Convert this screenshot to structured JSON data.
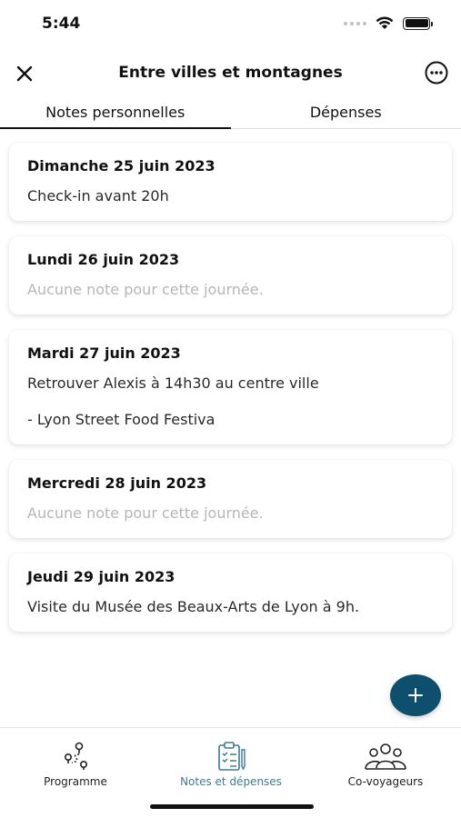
{
  "status_bar": {
    "time": "5:44"
  },
  "header": {
    "title": "Entre villes et montagnes"
  },
  "tabs": [
    {
      "label": "Notes personnelles",
      "active": true
    },
    {
      "label": "Dépenses",
      "active": false
    }
  ],
  "notes": [
    {
      "date": "Dimanche 25 juin 2023",
      "lines": [
        "Check-in avant 20h"
      ],
      "empty": false
    },
    {
      "date": "Lundi 26 juin 2023",
      "lines": [
        "Aucune note pour cette journée."
      ],
      "empty": true
    },
    {
      "date": "Mardi 27 juin 2023",
      "lines": [
        "Retrouver Alexis à 14h30 au centre ville",
        "- Lyon Street Food Festiva"
      ],
      "empty": false
    },
    {
      "date": "Mercredi 28 juin 2023",
      "lines": [
        "Aucune note pour cette journée."
      ],
      "empty": true
    },
    {
      "date": "Jeudi 29 juin 2023",
      "lines": [
        "Visite du Musée des Beaux-Arts de Lyon à 9h."
      ],
      "empty": false
    }
  ],
  "fab": {
    "icon": "plus-icon",
    "color": "#0f4f6e"
  },
  "bottom_nav": [
    {
      "label": "Programme",
      "icon": "route-icon",
      "active": false
    },
    {
      "label": "Notes et dépenses",
      "icon": "clipboard-icon",
      "active": true
    },
    {
      "label": "Co-voyageurs",
      "icon": "group-icon",
      "active": false
    }
  ],
  "colors": {
    "accent": "#3b7d95",
    "placeholder": "#b6b6b6"
  }
}
